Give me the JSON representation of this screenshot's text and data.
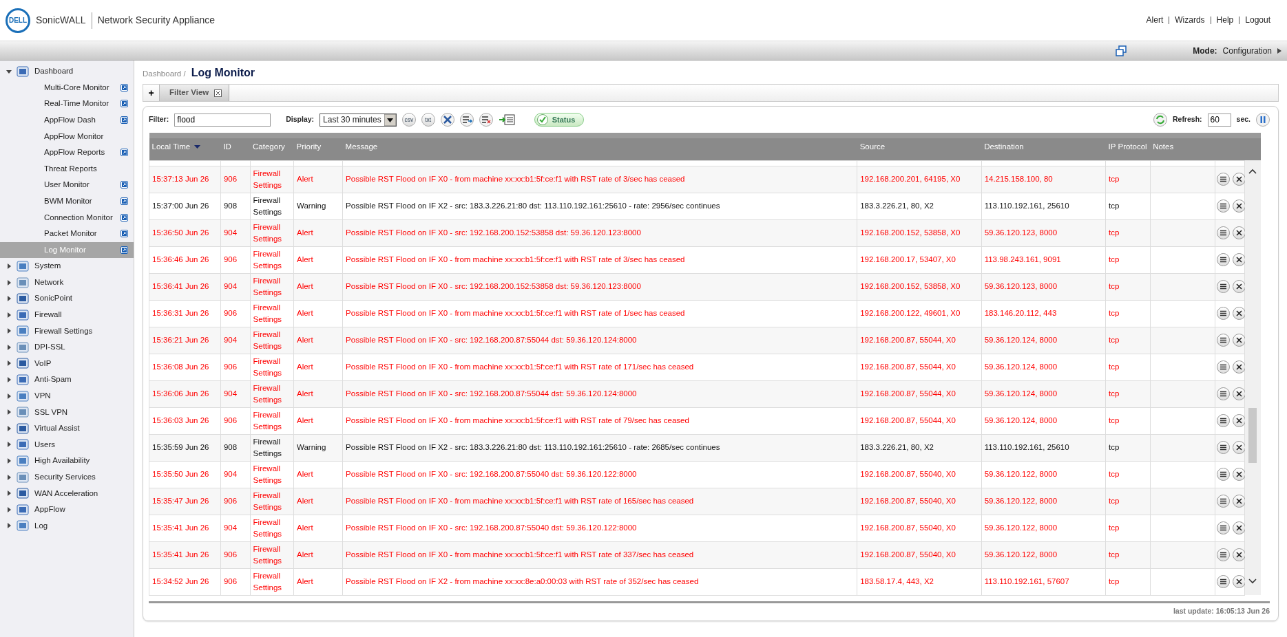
{
  "header": {
    "logo": "DELL",
    "brand": "SonicWALL",
    "product": "Network Security Appliance",
    "links": [
      "Alert",
      "Wizards",
      "Help",
      "Logout"
    ]
  },
  "mode_bar": {
    "label": "Mode:",
    "value": "Configuration"
  },
  "sidebar": {
    "items": [
      {
        "label": "Dashboard",
        "expanded": true,
        "children": [
          {
            "label": "Multi-Core Monitor",
            "popout": true,
            "selected": false
          },
          {
            "label": "Real-Time Monitor",
            "popout": true,
            "selected": false
          },
          {
            "label": "AppFlow Dash",
            "popout": true,
            "selected": false
          },
          {
            "label": "AppFlow Monitor",
            "popout": false,
            "selected": false
          },
          {
            "label": "AppFlow Reports",
            "popout": true,
            "selected": false
          },
          {
            "label": "Threat Reports",
            "popout": false,
            "selected": false
          },
          {
            "label": "User Monitor",
            "popout": true,
            "selected": false
          },
          {
            "label": "BWM Monitor",
            "popout": true,
            "selected": false
          },
          {
            "label": "Connection Monitor",
            "popout": true,
            "selected": false
          },
          {
            "label": "Packet Monitor",
            "popout": true,
            "selected": false
          },
          {
            "label": "Log Monitor",
            "popout": true,
            "selected": true
          }
        ]
      },
      {
        "label": "System",
        "expanded": false
      },
      {
        "label": "Network",
        "expanded": false
      },
      {
        "label": "SonicPoint",
        "expanded": false
      },
      {
        "label": "Firewall",
        "expanded": false
      },
      {
        "label": "Firewall Settings",
        "expanded": false
      },
      {
        "label": "DPI-SSL",
        "expanded": false
      },
      {
        "label": "VoIP",
        "expanded": false
      },
      {
        "label": "Anti-Spam",
        "expanded": false
      },
      {
        "label": "VPN",
        "expanded": false
      },
      {
        "label": "SSL VPN",
        "expanded": false
      },
      {
        "label": "Virtual Assist",
        "expanded": false
      },
      {
        "label": "Users",
        "expanded": false
      },
      {
        "label": "High Availability",
        "expanded": false
      },
      {
        "label": "Security Services",
        "expanded": false
      },
      {
        "label": "WAN Acceleration",
        "expanded": false
      },
      {
        "label": "AppFlow",
        "expanded": false
      },
      {
        "label": "Log",
        "expanded": false
      }
    ]
  },
  "breadcrumb": "Dashboard /",
  "title": "Log Monitor",
  "add_tab": "+",
  "tabs": [
    {
      "label": "Filter View",
      "selected": true
    }
  ],
  "toolbar": {
    "filter_label": "Filter:",
    "filter_value": "flood",
    "display_label": "Display:",
    "display_value": "Last 30 minutes",
    "export_buttons": [
      "csv",
      "txt"
    ],
    "status_button": "Status",
    "refresh_label": "Refresh:",
    "refresh_value": "60",
    "refresh_unit": "sec."
  },
  "table": {
    "columns": [
      {
        "label": "Local Time",
        "sorted": true
      },
      {
        "label": "ID",
        "sorted": false
      },
      {
        "label": "Category",
        "sorted": false
      },
      {
        "label": "Priority",
        "sorted": false
      },
      {
        "label": "Message",
        "sorted": false
      },
      {
        "label": "Source",
        "sorted": false
      },
      {
        "label": "Destination",
        "sorted": false
      },
      {
        "label": "IP Protocol",
        "sorted": false
      },
      {
        "label": "Notes",
        "sorted": false
      }
    ],
    "rows": [
      {
        "kind": "alert",
        "time": "15:37:13 Jun 26",
        "id": "906",
        "category": "Firewall Settings",
        "priority": "Alert",
        "message": "Possible RST Flood on IF X0 - from machine xx:xx:b1:5f:ce:f1 with RST rate of 3/sec has ceased",
        "source": "192.168.200.201, 64195, X0",
        "destination": "14.215.158.100, 80",
        "protocol": "tcp"
      },
      {
        "kind": "warning",
        "time": "15:37:00 Jun 26",
        "id": "908",
        "category": "Firewall Settings",
        "priority": "Warning",
        "message": "Possible RST Flood on IF X2 - src: 183.3.226.21:80 dst: 113.110.192.161:25610 - rate: 2956/sec continues",
        "source": "183.3.226.21, 80, X2",
        "destination": "113.110.192.161, 25610",
        "protocol": "tcp"
      },
      {
        "kind": "alert",
        "time": "15:36:50 Jun 26",
        "id": "904",
        "category": "Firewall Settings",
        "priority": "Alert",
        "message": "Possible RST Flood on IF X0 - src: 192.168.200.152:53858 dst: 59.36.120.123:8000",
        "source": "192.168.200.152, 53858, X0",
        "destination": "59.36.120.123, 8000",
        "protocol": "tcp"
      },
      {
        "kind": "alert",
        "time": "15:36:46 Jun 26",
        "id": "906",
        "category": "Firewall Settings",
        "priority": "Alert",
        "message": "Possible RST Flood on IF X0 - from machine xx:xx:b1:5f:ce:f1 with RST rate of 3/sec has ceased",
        "source": "192.168.200.17, 53407, X0",
        "destination": "113.98.243.161, 9091",
        "protocol": "tcp"
      },
      {
        "kind": "alert",
        "time": "15:36:41 Jun 26",
        "id": "904",
        "category": "Firewall Settings",
        "priority": "Alert",
        "message": "Possible RST Flood on IF X0 - src: 192.168.200.152:53858 dst: 59.36.120.123:8000",
        "source": "192.168.200.152, 53858, X0",
        "destination": "59.36.120.123, 8000",
        "protocol": "tcp"
      },
      {
        "kind": "alert",
        "time": "15:36:31 Jun 26",
        "id": "906",
        "category": "Firewall Settings",
        "priority": "Alert",
        "message": "Possible RST Flood on IF X0 - from machine xx:xx:b1:5f:ce:f1 with RST rate of 1/sec has ceased",
        "source": "192.168.200.122, 49601, X0",
        "destination": "183.146.20.112, 443",
        "protocol": "tcp"
      },
      {
        "kind": "alert",
        "time": "15:36:21 Jun 26",
        "id": "904",
        "category": "Firewall Settings",
        "priority": "Alert",
        "message": "Possible RST Flood on IF X0 - src: 192.168.200.87:55044 dst: 59.36.120.124:8000",
        "source": "192.168.200.87, 55044, X0",
        "destination": "59.36.120.124, 8000",
        "protocol": "tcp"
      },
      {
        "kind": "alert",
        "time": "15:36:08 Jun 26",
        "id": "906",
        "category": "Firewall Settings",
        "priority": "Alert",
        "message": "Possible RST Flood on IF X0 - from machine xx:xx:b1:5f:ce:f1 with RST rate of 171/sec has ceased",
        "source": "192.168.200.87, 55044, X0",
        "destination": "59.36.120.124, 8000",
        "protocol": "tcp"
      },
      {
        "kind": "alert",
        "time": "15:36:06 Jun 26",
        "id": "904",
        "category": "Firewall Settings",
        "priority": "Alert",
        "message": "Possible RST Flood on IF X0 - src: 192.168.200.87:55044 dst: 59.36.120.124:8000",
        "source": "192.168.200.87, 55044, X0",
        "destination": "59.36.120.124, 8000",
        "protocol": "tcp"
      },
      {
        "kind": "alert",
        "time": "15:36:03 Jun 26",
        "id": "906",
        "category": "Firewall Settings",
        "priority": "Alert",
        "message": "Possible RST Flood on IF X0 - from machine xx:xx:b1:5f:ce:f1 with RST rate of 79/sec has ceased",
        "source": "192.168.200.87, 55044, X0",
        "destination": "59.36.120.124, 8000",
        "protocol": "tcp"
      },
      {
        "kind": "warning",
        "time": "15:35:59 Jun 26",
        "id": "908",
        "category": "Firewall Settings",
        "priority": "Warning",
        "message": "Possible RST Flood on IF X2 - src: 183.3.226.21:80 dst: 113.110.192.161:25610 - rate: 2685/sec continues",
        "source": "183.3.226.21, 80, X2",
        "destination": "113.110.192.161, 25610",
        "protocol": "tcp"
      },
      {
        "kind": "alert",
        "time": "15:35:50 Jun 26",
        "id": "904",
        "category": "Firewall Settings",
        "priority": "Alert",
        "message": "Possible RST Flood on IF X0 - src: 192.168.200.87:55040 dst: 59.36.120.122:8000",
        "source": "192.168.200.87, 55040, X0",
        "destination": "59.36.120.122, 8000",
        "protocol": "tcp"
      },
      {
        "kind": "alert",
        "time": "15:35:47 Jun 26",
        "id": "906",
        "category": "Firewall Settings",
        "priority": "Alert",
        "message": "Possible RST Flood on IF X0 - from machine xx:xx:b1:5f:ce:f1 with RST rate of 165/sec has ceased",
        "source": "192.168.200.87, 55040, X0",
        "destination": "59.36.120.122, 8000",
        "protocol": "tcp"
      },
      {
        "kind": "alert",
        "time": "15:35:41 Jun 26",
        "id": "904",
        "category": "Firewall Settings",
        "priority": "Alert",
        "message": "Possible RST Flood on IF X0 - src: 192.168.200.87:55040 dst: 59.36.120.122:8000",
        "source": "192.168.200.87, 55040, X0",
        "destination": "59.36.120.122, 8000",
        "protocol": "tcp"
      },
      {
        "kind": "alert",
        "time": "15:35:41 Jun 26",
        "id": "906",
        "category": "Firewall Settings",
        "priority": "Alert",
        "message": "Possible RST Flood on IF X0 - from machine xx:xx:b1:5f:ce:f1 with RST rate of 337/sec has ceased",
        "source": "192.168.200.87, 55040, X0",
        "destination": "59.36.120.122, 8000",
        "protocol": "tcp"
      },
      {
        "kind": "alert",
        "time": "15:34:52 Jun 26",
        "id": "906",
        "category": "Firewall Settings",
        "priority": "Alert",
        "message": "Possible RST Flood on IF X2 - from machine xx:xx:8e:a0:00:03 with RST rate of 352/sec has ceased",
        "source": "183.58.17.4, 443, X2",
        "destination": "113.110.192.161, 57607",
        "protocol": "tcp"
      }
    ]
  },
  "last_update": "last update: 16:05:13 Jun 26"
}
